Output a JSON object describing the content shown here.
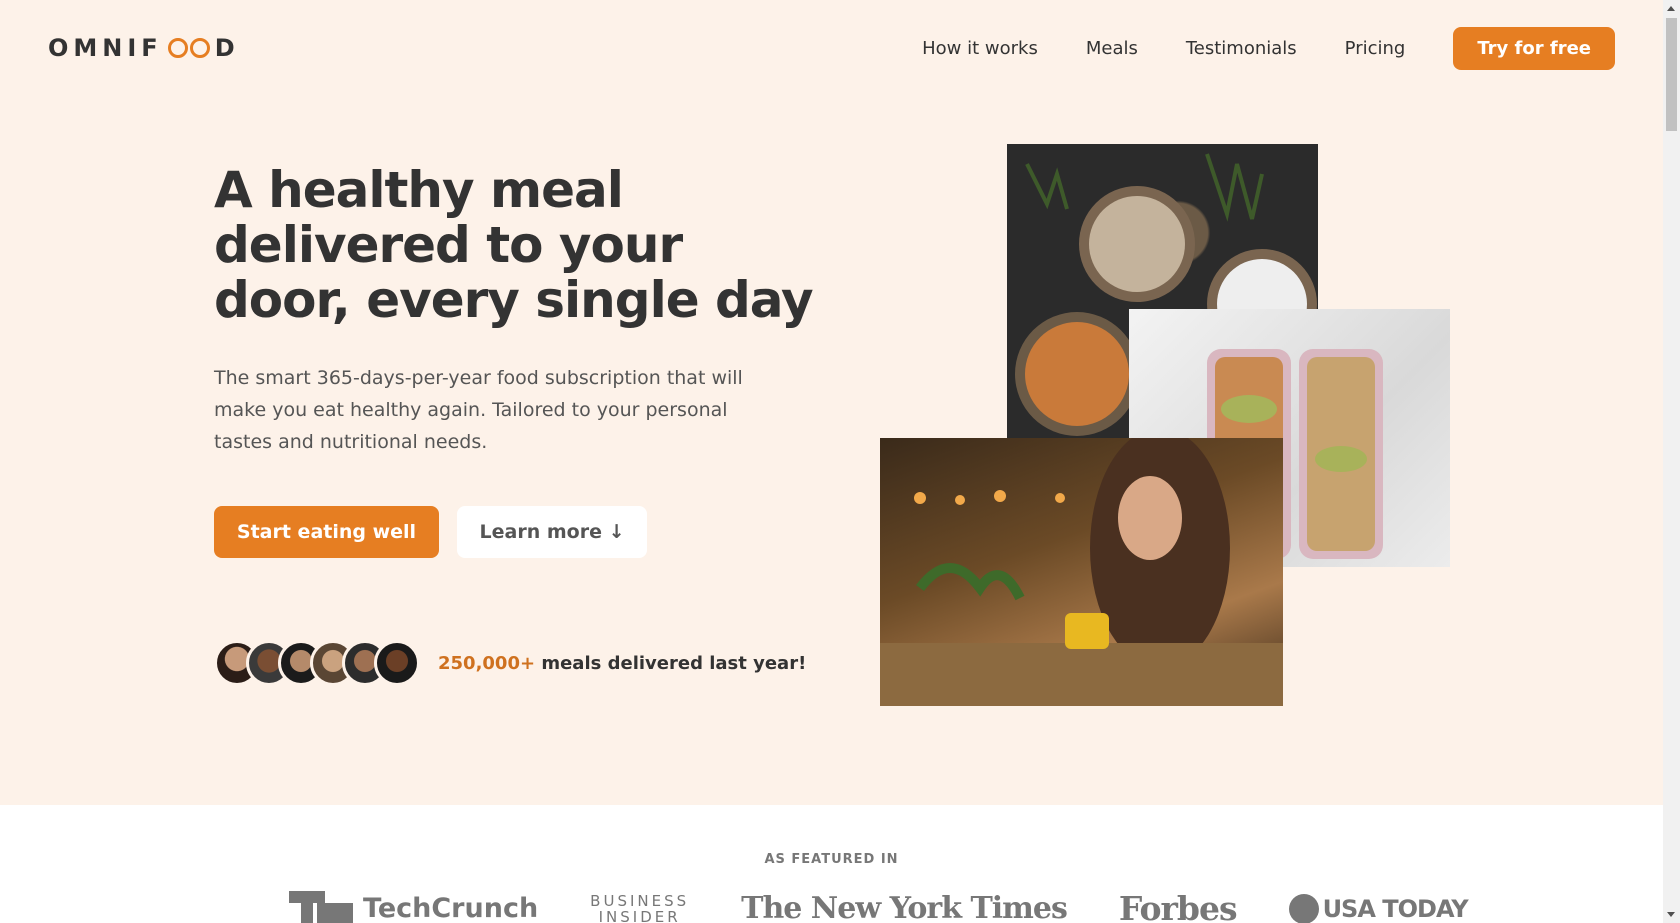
{
  "header": {
    "logo_left": "OMNIF",
    "logo_right": "D",
    "nav": [
      "How it works",
      "Meals",
      "Testimonials",
      "Pricing"
    ],
    "cta": "Try for free"
  },
  "hero": {
    "title": "A healthy meal delivered to your door, every single day",
    "description": "The smart 365-days-per-year food subscription that will make you eat healthy again. Tailored to your personal tastes and nutritional needs.",
    "primary_button": "Start eating well",
    "secondary_button": "Learn more ↓",
    "delivered_count": "250,000+",
    "delivered_text": " meals delivered last year!"
  },
  "featured": {
    "label": "AS FEATURED IN",
    "logos": [
      "TechCrunch",
      "BUSINESS",
      "INSIDER",
      "The New York Times",
      "Forbes",
      "USA TODAY"
    ]
  },
  "colors": {
    "accent": "#e67e22",
    "background": "#fdf2e9"
  }
}
